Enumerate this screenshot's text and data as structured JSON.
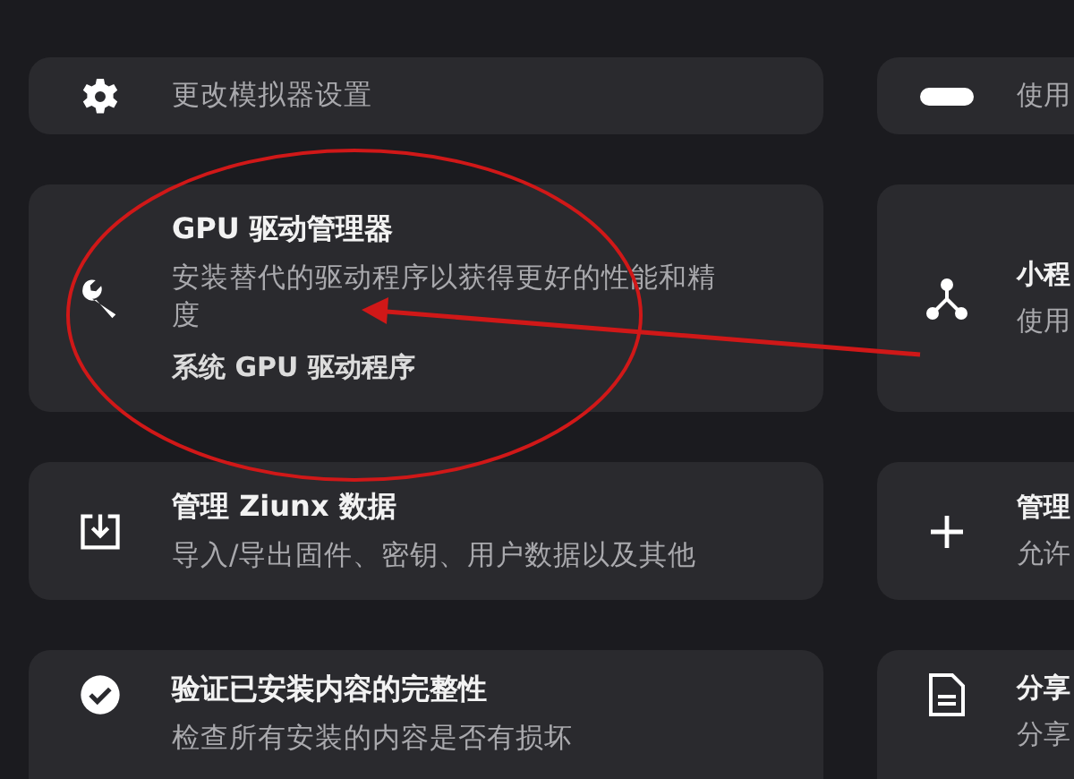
{
  "left_cards": [
    {
      "description": "更改模拟器设置"
    },
    {
      "title": "GPU 驱动管理器",
      "description": "安装替代的驱动程序以获得更好的性能和精度",
      "value": "系统 GPU 驱动程序"
    },
    {
      "title": "管理 Ziunx 数据",
      "description": "导入/导出固件、密钥、用户数据以及其他"
    },
    {
      "title": "验证已安装内容的完整性",
      "description": "检查所有安装的内容是否有损坏"
    }
  ],
  "right_cards": [
    {
      "description": "使用"
    },
    {
      "title": "小程",
      "description": "使用"
    },
    {
      "title": "管理",
      "description": "允许"
    },
    {
      "title": "分享",
      "description": "分享"
    }
  ]
}
